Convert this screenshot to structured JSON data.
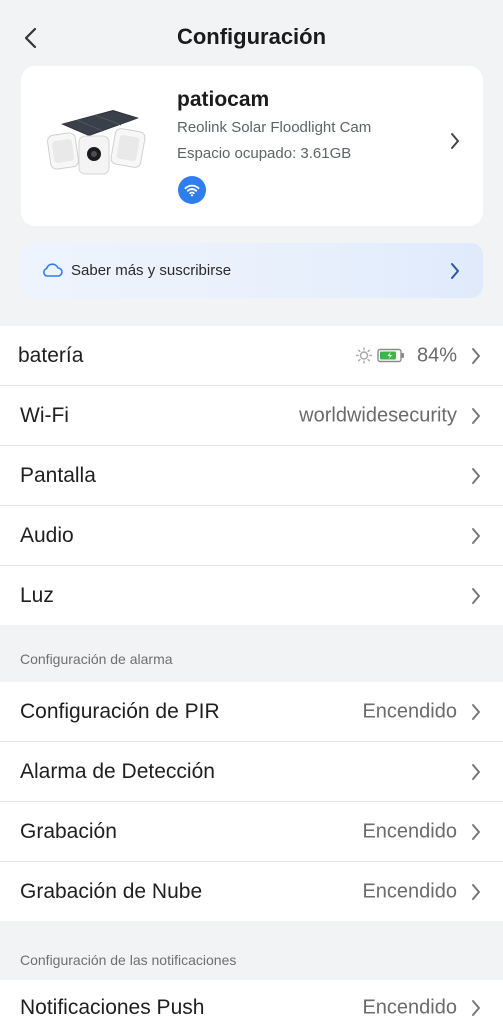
{
  "header": {
    "title": "Configuración"
  },
  "device": {
    "name": "patiocam",
    "model": "Reolink Solar Floodlight Cam",
    "storage": "Espacio ocupado: 3.61GB",
    "connection_icon": "wifi-icon"
  },
  "banner": {
    "label": "Saber más y suscribirse",
    "icon": "cloud-icon"
  },
  "general": {
    "battery_label": "batería",
    "battery_value": "84%",
    "battery_level": 0.84,
    "wifi_label": "Wi-Fi",
    "wifi_value": "worldwidesecurity",
    "display_label": "Pantalla",
    "audio_label": "Audio",
    "light_label": "Luz"
  },
  "alarm_section": {
    "title": "Configuración de alarma",
    "pir_label": "Configuración de PIR",
    "pir_value": "Encendido",
    "detection_label": "Alarma de Detección",
    "recording_label": "Grabación",
    "recording_value": "Encendido",
    "cloud_recording_label": "Grabación de Nube",
    "cloud_recording_value": "Encendido"
  },
  "notifications_section": {
    "title": "Configuración de las notificaciones",
    "push_label": "Notificaciones Push",
    "push_value": "Encendido"
  },
  "colors": {
    "accent": "#2f7ef0",
    "background": "#f2f3f5",
    "battery_green": "#3cb64a"
  }
}
